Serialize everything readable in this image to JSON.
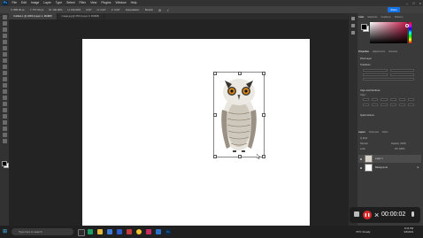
{
  "app": {
    "name": "Ps"
  },
  "menu": [
    "File",
    "Edit",
    "Image",
    "Layer",
    "Type",
    "Select",
    "Filter",
    "View",
    "Plugins",
    "Window",
    "Help"
  ],
  "options_bar": {
    "items": [
      "X: 885.00 px",
      "Y: 577.00 px",
      "W: 100.00%",
      "H: 100.00%",
      "0.00°",
      "H: 0.00°",
      "V: 0.00°",
      "Interpolation:",
      "Bicubic"
    ],
    "share_label": "Share"
  },
  "doc_tabs": [
    {
      "label": "Untitled-1 @ 100% (Layer 1, RGB/8)",
      "active": true
    },
    {
      "label": "image.jpg @ 25% (Layer 0, RGB/8)",
      "active": false
    }
  ],
  "panels": {
    "color_tabs": [
      "Color",
      "Swatches",
      "Gradients",
      "Patterns"
    ],
    "properties_tabs": [
      "Properties",
      "Adjustments",
      "Libraries"
    ],
    "properties": {
      "section_pixel": "Pixel Layer",
      "section_transform": "Transform",
      "section_align": "Align and Distribute",
      "align_label": "Align:",
      "section_quick": "Quick Actions"
    },
    "layers_tabs": [
      "Layers",
      "Channels",
      "Paths"
    ],
    "layers_kind": "Q Kind",
    "layers_blend": "Normal",
    "layers_opacity": "Opacity: 100%",
    "layers_lock": "Lock:",
    "layers_fill": "Fill: 100%",
    "layers": [
      {
        "name": "Layer 1",
        "selected": true
      },
      {
        "name": "Background",
        "selected": false
      }
    ]
  },
  "taskbar": {
    "search_placeholder": "Type here to search",
    "weather": "79°F Cloudy",
    "time": "8:44 PM",
    "date": "9/6/2023"
  },
  "recorder": {
    "time": "00:00:02"
  },
  "colors": {
    "accent": "#1473e6",
    "record": "#d62828"
  }
}
